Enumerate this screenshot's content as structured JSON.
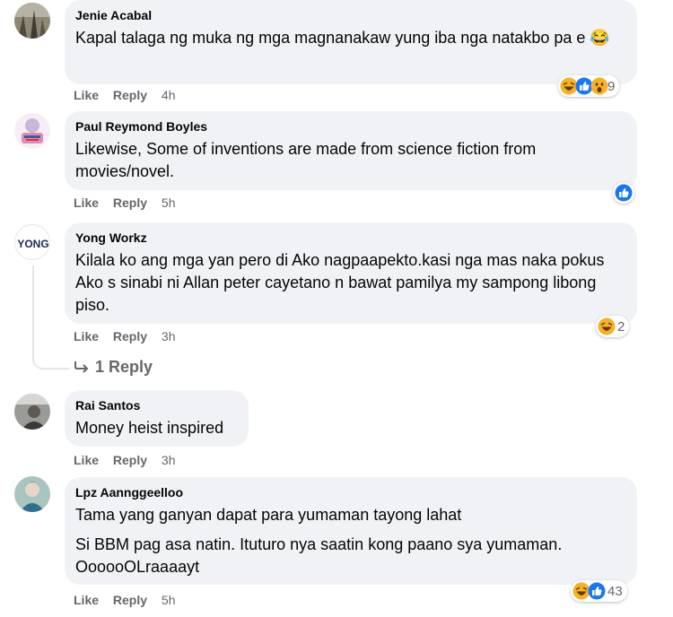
{
  "action_labels": {
    "like": "Like",
    "reply": "Reply"
  },
  "comments": [
    {
      "author": "Jenie Acabal",
      "lines": [
        "Kapal talaga ng muka ng mga magnanakaw yung iba nga natakbo pa e 😂"
      ],
      "time": "4h",
      "reactions": [
        "haha-icon",
        "like-icon",
        "wow-icon"
      ],
      "reaction_count": "9"
    },
    {
      "author": "Paul Reymond Boyles",
      "lines": [
        "Likewise, Some of inventions are made from science fiction from movies/novel."
      ],
      "time": "5h",
      "reactions": [
        "like-icon"
      ],
      "reaction_count": ""
    },
    {
      "author": "Yong Workz",
      "lines": [
        "Kilala ko ang mga yan pero di Ako nagpaapekto.kasi nga mas naka pokus Ako s sinabi ni Allan peter cayetano n bawat pamilya my sampong libong piso."
      ],
      "time": "3h",
      "reactions": [
        "haha-icon"
      ],
      "reaction_count": "2",
      "replies_label": "1 Reply",
      "avatar_text": "YONG"
    },
    {
      "author": "Rai Santos",
      "lines": [
        "Money heist inspired"
      ],
      "time": "3h"
    },
    {
      "author": "Lpz Aannggeelloo",
      "lines": [
        "Tama yang ganyan dapat para yumaman tayong lahat",
        "Si BBM pag asa natin. Ituturo nya saatin kong paano sya yumaman. OooooOLraaaayt"
      ],
      "time": "5h",
      "reactions": [
        "haha-icon",
        "like-icon"
      ],
      "reaction_count": "43"
    }
  ],
  "colors": {
    "bubble_bg": "#f0f2f5",
    "meta_text": "#65676b",
    "like_blue": "#1877f2",
    "haha_yellow": "#f7b125"
  }
}
